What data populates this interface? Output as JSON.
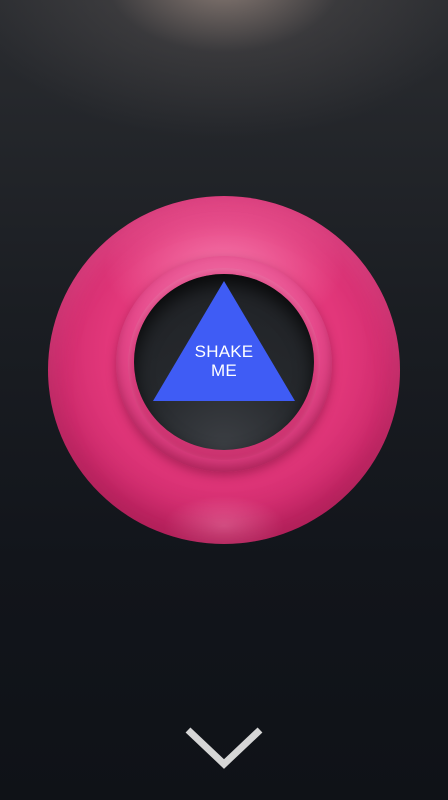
{
  "answer": {
    "line1": "SHAKE",
    "line2": "ME"
  },
  "icons": {
    "bottom": "chevron-down-icon"
  },
  "colors": {
    "ball": "#e2377a",
    "triangle": "#3f5cf5",
    "window": "#25282c",
    "text": "#ffffff"
  }
}
